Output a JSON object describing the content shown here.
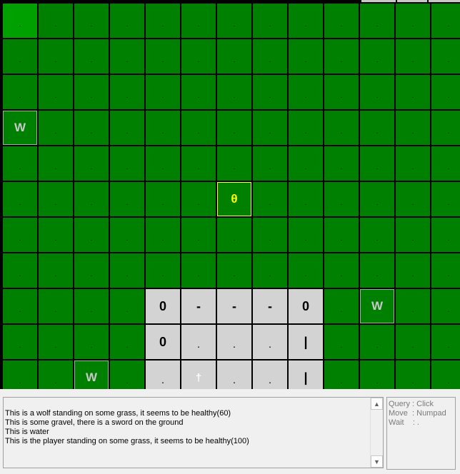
{
  "board": {
    "symbols": {
      "grass": ".",
      "wolf": "W",
      "player": "θ",
      "gravel_post": "0",
      "gravel_hwall": "-",
      "gravel_vwall": "|",
      "gravel_floor": ".",
      "sword": "†"
    },
    "rows": [
      [
        "grass-lit",
        "grass",
        "grass",
        "grass",
        "grass",
        "grass",
        "grass",
        "grass",
        "grass",
        "grass",
        "grass",
        "grass",
        "grass"
      ],
      [
        "grass",
        "grass",
        "grass",
        "grass",
        "grass",
        "grass",
        "grass",
        "grass",
        "grass",
        "grass",
        "grass",
        "grass",
        "grass"
      ],
      [
        "grass",
        "grass",
        "grass",
        "grass",
        "grass",
        "grass",
        "grass",
        "grass",
        "grass",
        "grass",
        "grass",
        "grass",
        "grass"
      ],
      [
        "wolf",
        "grass",
        "grass",
        "grass",
        "grass",
        "grass",
        "grass",
        "grass",
        "grass",
        "grass",
        "grass",
        "grass",
        "grass"
      ],
      [
        "grass",
        "grass",
        "grass",
        "grass",
        "grass",
        "grass",
        "grass",
        "grass",
        "grass",
        "grass",
        "grass",
        "grass",
        "grass"
      ],
      [
        "grass",
        "grass",
        "grass",
        "grass",
        "grass",
        "grass",
        "player",
        "grass",
        "grass",
        "grass",
        "grass",
        "grass",
        "grass"
      ],
      [
        "grass",
        "grass",
        "grass",
        "grass",
        "grass",
        "grass",
        "grass",
        "grass",
        "grass",
        "grass",
        "grass",
        "grass",
        "grass"
      ],
      [
        "grass",
        "grass",
        "grass",
        "grass",
        "grass",
        "grass",
        "grass",
        "grass",
        "grass",
        "grass",
        "grass",
        "grass",
        "grass"
      ],
      [
        "grass",
        "grass",
        "grass",
        "grass",
        "gravel_post",
        "gravel_hwall",
        "gravel_hwall",
        "gravel_hwall",
        "gravel_post",
        "grass",
        "wolf",
        "grass",
        "grass"
      ],
      [
        "grass",
        "grass",
        "grass",
        "grass",
        "gravel_post",
        "gravel_floor",
        "gravel_floor",
        "gravel_floor",
        "gravel_vwall",
        "grass",
        "grass",
        "grass",
        "grass"
      ],
      [
        "grass",
        "grass",
        "wolf",
        "grass",
        "gravel_floor",
        "sword",
        "gravel_floor",
        "gravel_floor",
        "gravel_vwall",
        "grass",
        "grass",
        "grass",
        "grass"
      ]
    ]
  },
  "log": {
    "lines": [
      "This is a wolf standing on some grass, it seems to be healthy(60)",
      "This is some gravel, there is a sword on the ground",
      "This is water",
      "This is the player standing on some grass, it seems to be healthy(100)"
    ],
    "scroll_up": "▲",
    "scroll_down": "▼"
  },
  "help": {
    "lines": [
      "Query : Click",
      "Move  : Numpad",
      "Wait    : ."
    ]
  }
}
